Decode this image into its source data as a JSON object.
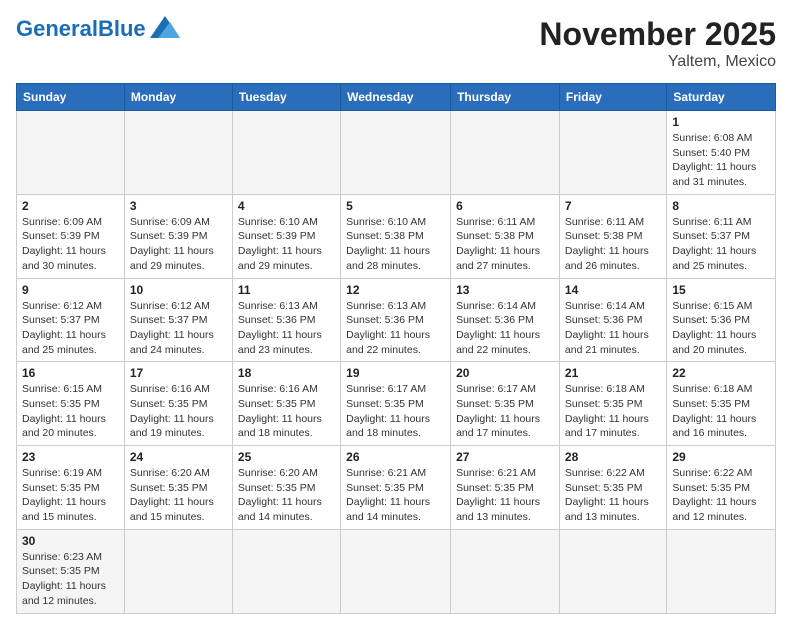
{
  "header": {
    "logo_general": "General",
    "logo_blue": "Blue",
    "month": "November 2025",
    "location": "Yaltem, Mexico"
  },
  "weekdays": [
    "Sunday",
    "Monday",
    "Tuesday",
    "Wednesday",
    "Thursday",
    "Friday",
    "Saturday"
  ],
  "days": [
    {
      "num": "",
      "info": ""
    },
    {
      "num": "",
      "info": ""
    },
    {
      "num": "",
      "info": ""
    },
    {
      "num": "",
      "info": ""
    },
    {
      "num": "",
      "info": ""
    },
    {
      "num": "",
      "info": ""
    },
    {
      "num": "1",
      "info": "Sunrise: 6:08 AM\nSunset: 5:40 PM\nDaylight: 11 hours\nand 31 minutes."
    },
    {
      "num": "2",
      "info": "Sunrise: 6:09 AM\nSunset: 5:39 PM\nDaylight: 11 hours\nand 30 minutes."
    },
    {
      "num": "3",
      "info": "Sunrise: 6:09 AM\nSunset: 5:39 PM\nDaylight: 11 hours\nand 29 minutes."
    },
    {
      "num": "4",
      "info": "Sunrise: 6:10 AM\nSunset: 5:39 PM\nDaylight: 11 hours\nand 29 minutes."
    },
    {
      "num": "5",
      "info": "Sunrise: 6:10 AM\nSunset: 5:38 PM\nDaylight: 11 hours\nand 28 minutes."
    },
    {
      "num": "6",
      "info": "Sunrise: 6:11 AM\nSunset: 5:38 PM\nDaylight: 11 hours\nand 27 minutes."
    },
    {
      "num": "7",
      "info": "Sunrise: 6:11 AM\nSunset: 5:38 PM\nDaylight: 11 hours\nand 26 minutes."
    },
    {
      "num": "8",
      "info": "Sunrise: 6:11 AM\nSunset: 5:37 PM\nDaylight: 11 hours\nand 25 minutes."
    },
    {
      "num": "9",
      "info": "Sunrise: 6:12 AM\nSunset: 5:37 PM\nDaylight: 11 hours\nand 25 minutes."
    },
    {
      "num": "10",
      "info": "Sunrise: 6:12 AM\nSunset: 5:37 PM\nDaylight: 11 hours\nand 24 minutes."
    },
    {
      "num": "11",
      "info": "Sunrise: 6:13 AM\nSunset: 5:36 PM\nDaylight: 11 hours\nand 23 minutes."
    },
    {
      "num": "12",
      "info": "Sunrise: 6:13 AM\nSunset: 5:36 PM\nDaylight: 11 hours\nand 22 minutes."
    },
    {
      "num": "13",
      "info": "Sunrise: 6:14 AM\nSunset: 5:36 PM\nDaylight: 11 hours\nand 22 minutes."
    },
    {
      "num": "14",
      "info": "Sunrise: 6:14 AM\nSunset: 5:36 PM\nDaylight: 11 hours\nand 21 minutes."
    },
    {
      "num": "15",
      "info": "Sunrise: 6:15 AM\nSunset: 5:36 PM\nDaylight: 11 hours\nand 20 minutes."
    },
    {
      "num": "16",
      "info": "Sunrise: 6:15 AM\nSunset: 5:35 PM\nDaylight: 11 hours\nand 20 minutes."
    },
    {
      "num": "17",
      "info": "Sunrise: 6:16 AM\nSunset: 5:35 PM\nDaylight: 11 hours\nand 19 minutes."
    },
    {
      "num": "18",
      "info": "Sunrise: 6:16 AM\nSunset: 5:35 PM\nDaylight: 11 hours\nand 18 minutes."
    },
    {
      "num": "19",
      "info": "Sunrise: 6:17 AM\nSunset: 5:35 PM\nDaylight: 11 hours\nand 18 minutes."
    },
    {
      "num": "20",
      "info": "Sunrise: 6:17 AM\nSunset: 5:35 PM\nDaylight: 11 hours\nand 17 minutes."
    },
    {
      "num": "21",
      "info": "Sunrise: 6:18 AM\nSunset: 5:35 PM\nDaylight: 11 hours\nand 17 minutes."
    },
    {
      "num": "22",
      "info": "Sunrise: 6:18 AM\nSunset: 5:35 PM\nDaylight: 11 hours\nand 16 minutes."
    },
    {
      "num": "23",
      "info": "Sunrise: 6:19 AM\nSunset: 5:35 PM\nDaylight: 11 hours\nand 15 minutes."
    },
    {
      "num": "24",
      "info": "Sunrise: 6:20 AM\nSunset: 5:35 PM\nDaylight: 11 hours\nand 15 minutes."
    },
    {
      "num": "25",
      "info": "Sunrise: 6:20 AM\nSunset: 5:35 PM\nDaylight: 11 hours\nand 14 minutes."
    },
    {
      "num": "26",
      "info": "Sunrise: 6:21 AM\nSunset: 5:35 PM\nDaylight: 11 hours\nand 14 minutes."
    },
    {
      "num": "27",
      "info": "Sunrise: 6:21 AM\nSunset: 5:35 PM\nDaylight: 11 hours\nand 13 minutes."
    },
    {
      "num": "28",
      "info": "Sunrise: 6:22 AM\nSunset: 5:35 PM\nDaylight: 11 hours\nand 13 minutes."
    },
    {
      "num": "29",
      "info": "Sunrise: 6:22 AM\nSunset: 5:35 PM\nDaylight: 11 hours\nand 12 minutes."
    },
    {
      "num": "30",
      "info": "Sunrise: 6:23 AM\nSunset: 5:35 PM\nDaylight: 11 hours\nand 12 minutes."
    },
    {
      "num": "",
      "info": ""
    },
    {
      "num": "",
      "info": ""
    },
    {
      "num": "",
      "info": ""
    },
    {
      "num": "",
      "info": ""
    },
    {
      "num": "",
      "info": ""
    }
  ]
}
